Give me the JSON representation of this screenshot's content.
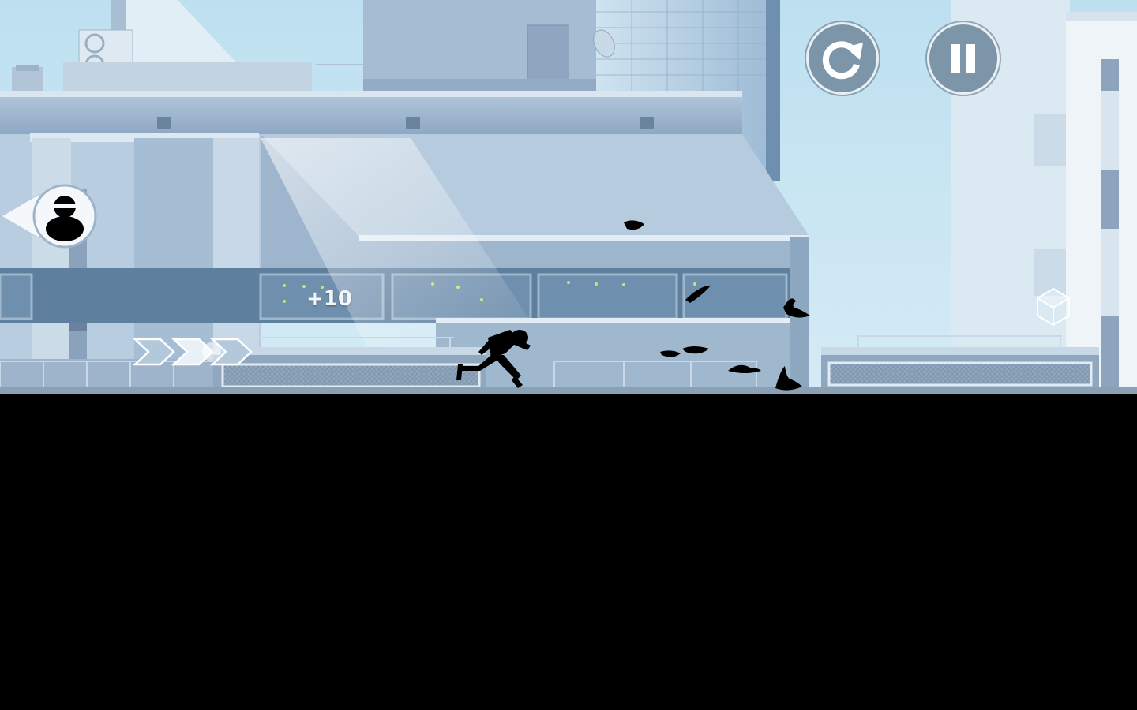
{
  "hud": {
    "restart_icon": "restart-icon",
    "pause_icon": "pause-icon",
    "score_popup": "+10",
    "pursuer_icon": "pursuer-indicator-icon",
    "boost_icon": "speed-chevrons-icon",
    "bonus_icon": "bonus-cube-icon"
  },
  "colors": {
    "sky": "#bfe0ef",
    "building": "#a9c2d8",
    "hud_button": "#7d95a8",
    "silhouette": "#000000"
  }
}
